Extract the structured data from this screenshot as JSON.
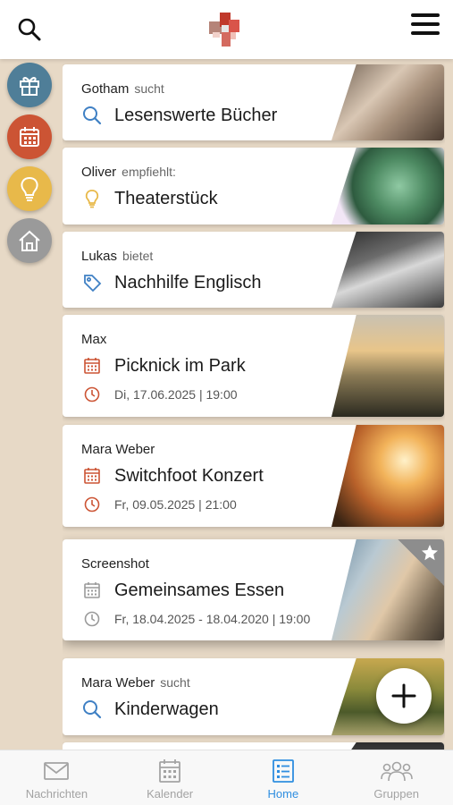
{
  "header": {
    "search_icon": "search-icon",
    "logo": "app-logo",
    "menu_icon": "hamburger-menu-icon"
  },
  "rail": {
    "items": [
      {
        "icon": "gift-icon",
        "color": "#4f7e98"
      },
      {
        "icon": "calendar-icon",
        "color": "#cc5434"
      },
      {
        "icon": "lightbulb-icon",
        "color": "#e8b94a"
      },
      {
        "icon": "home-icon",
        "color": "#9a9a9a"
      }
    ]
  },
  "feed": {
    "cards": [
      {
        "author": "Gotham",
        "verb": "sucht",
        "title": "Lesenswerte Bücher",
        "icon": "search-icon"
      },
      {
        "author": "Oliver",
        "verb": "empfiehlt:",
        "title": "Theaterstück",
        "icon": "lightbulb-icon"
      },
      {
        "author": "Lukas",
        "verb": "bietet",
        "title": "Nachhilfe Englisch",
        "icon": "tag-icon"
      },
      {
        "author": "Max",
        "verb": "",
        "title": "Picknick im Park",
        "icon": "calendar-icon",
        "date": "Di, 17.06.2025 | 19:00"
      },
      {
        "author": "Mara Weber",
        "verb": "",
        "title": "Switchfoot Konzert",
        "icon": "calendar-icon",
        "date": "Fr, 09.05.2025 | 21:00"
      },
      {
        "author": "Screenshot",
        "verb": "",
        "title": "Gemeinsames Essen",
        "icon": "calendar-icon",
        "date": "Fr, 18.04.2025 - 18.04.2020 | 19:00",
        "starred": true
      },
      {
        "author": "Mara Weber",
        "verb": "sucht",
        "title": "Kinderwagen",
        "icon": "search-icon"
      }
    ]
  },
  "fab": {
    "icon": "plus-icon"
  },
  "bottom_nav": {
    "items": [
      {
        "label": "Nachrichten",
        "icon": "mail-icon",
        "active": false
      },
      {
        "label": "Kalender",
        "icon": "calendar-icon",
        "active": false
      },
      {
        "label": "Home",
        "icon": "list-icon",
        "active": true
      },
      {
        "label": "Gruppen",
        "icon": "group-icon",
        "active": false
      }
    ]
  },
  "colors": {
    "accent_blue": "#2f8ee0",
    "search_icon_blue": "#3f80c4",
    "event_red": "#cc5434",
    "bulb_yellow": "#e8b94a",
    "background": "#e7d9c6"
  }
}
